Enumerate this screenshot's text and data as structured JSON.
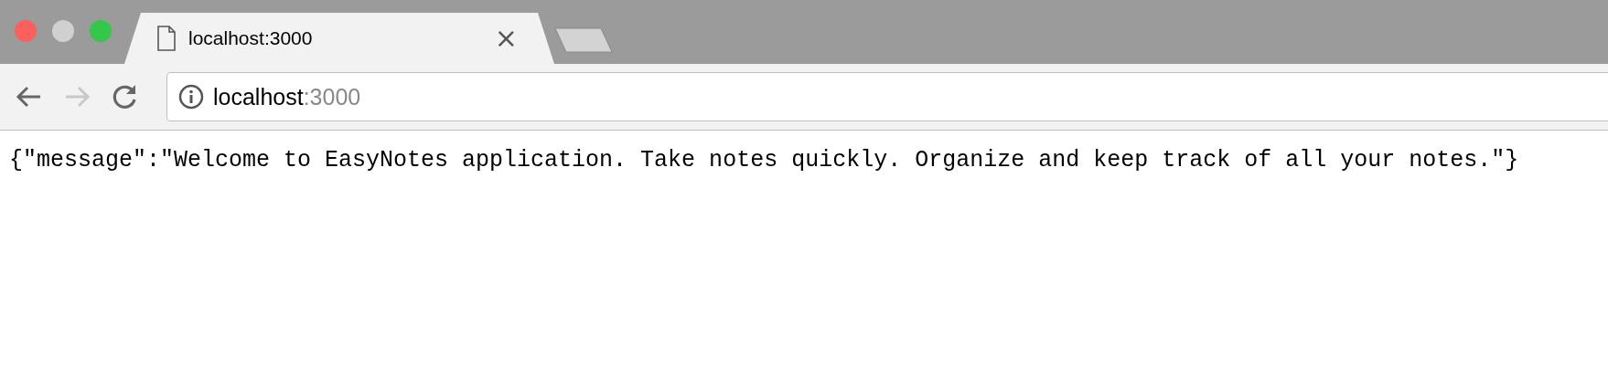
{
  "window": {
    "controls": [
      {
        "kind": "close"
      },
      {
        "kind": "minimize"
      },
      {
        "kind": "maximize"
      }
    ]
  },
  "tabs": [
    {
      "title": "localhost:3000",
      "close": "×",
      "selected": true
    }
  ],
  "toolbar": {
    "back_disabled": false,
    "forward_disabled": true
  },
  "address_bar": {
    "host": "localhost",
    "port": ":3000"
  },
  "page": {
    "body": "{\"message\":\"Welcome to EasyNotes application. Take notes quickly. Organize and keep track of all your notes.\"}"
  }
}
